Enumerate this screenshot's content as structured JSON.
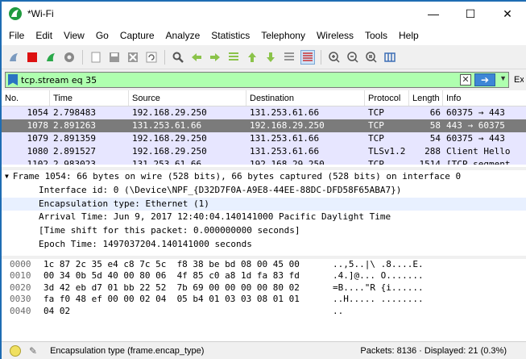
{
  "window": {
    "title": "*Wi-Fi",
    "minimize": "—",
    "maximize": "☐",
    "close": "✕"
  },
  "menu": [
    "File",
    "Edit",
    "View",
    "Go",
    "Capture",
    "Analyze",
    "Statistics",
    "Telephony",
    "Wireless",
    "Tools",
    "Help"
  ],
  "filter": {
    "value": "tcp.stream eq 35",
    "expression_label": "Ex",
    "clear": "✕",
    "apply": "➔",
    "dropdown": "▼"
  },
  "packet_list": {
    "columns": [
      "No.",
      "Time",
      "Source",
      "Destination",
      "Protocol",
      "Length",
      "Info"
    ],
    "rows": [
      {
        "no": "1054",
        "time": "2.798483",
        "src": "192.168.29.250",
        "dst": "131.253.61.66",
        "proto": "TCP",
        "len": "66",
        "info": "60375 → 443"
      },
      {
        "no": "1078",
        "time": "2.891263",
        "src": "131.253.61.66",
        "dst": "192.168.29.250",
        "proto": "TCP",
        "len": "58",
        "info": "443 → 60375"
      },
      {
        "no": "1079",
        "time": "2.891359",
        "src": "192.168.29.250",
        "dst": "131.253.61.66",
        "proto": "TCP",
        "len": "54",
        "info": "60375 → 443"
      },
      {
        "no": "1080",
        "time": "2.891527",
        "src": "192.168.29.250",
        "dst": "131.253.61.66",
        "proto": "TLSv1.2",
        "len": "288",
        "info": "Client Hello"
      },
      {
        "no": "1102",
        "time": "2.983023",
        "src": "131.253.61.66",
        "dst": "192.168.29.250",
        "proto": "TCP",
        "len": "1514",
        "info": "[TCP segment"
      }
    ]
  },
  "details": {
    "frame_summary": "Frame 1054: 66 bytes on wire (528 bits), 66 bytes captured (528 bits) on interface 0",
    "lines": [
      "Interface id: 0 (\\Device\\NPF_{D32D7F0A-A9E8-44EE-88DC-DFD58F65ABA7})",
      "Encapsulation type: Ethernet (1)",
      "Arrival Time: Jun  9, 2017 12:40:04.140141000 Pacific Daylight Time",
      "[Time shift for this packet: 0.000000000 seconds]",
      "Epoch Time: 1497037204.140141000 seconds"
    ]
  },
  "bytes": [
    {
      "offset": "0000",
      "hex": "1c 87 2c 35 e4 c8 7c 5c  f8 38 be bd 08 00 45 00",
      "ascii": "..,5..|\\ .8....E."
    },
    {
      "offset": "0010",
      "hex": "00 34 0b 5d 40 00 80 06  4f 85 c0 a8 1d fa 83 fd",
      "ascii": ".4.]@... O......."
    },
    {
      "offset": "0020",
      "hex": "3d 42 eb d7 01 bb 22 52  7b 69 00 00 00 00 80 02",
      "ascii": "=B....\"R {i......"
    },
    {
      "offset": "0030",
      "hex": "fa f0 48 ef 00 00 02 04  05 b4 01 03 03 08 01 01",
      "ascii": "..H..... ........"
    },
    {
      "offset": "0040",
      "hex": "04 02",
      "ascii": ".."
    }
  ],
  "status": {
    "field": "Encapsulation type (frame.encap_type)",
    "packets": "Packets: 8136 · Displayed: 21 (0.3%)"
  },
  "colors": {
    "filter_ok": "#afffaf",
    "tcp_row": "#e7e6ff",
    "selected_row": "#7b7b7b"
  }
}
